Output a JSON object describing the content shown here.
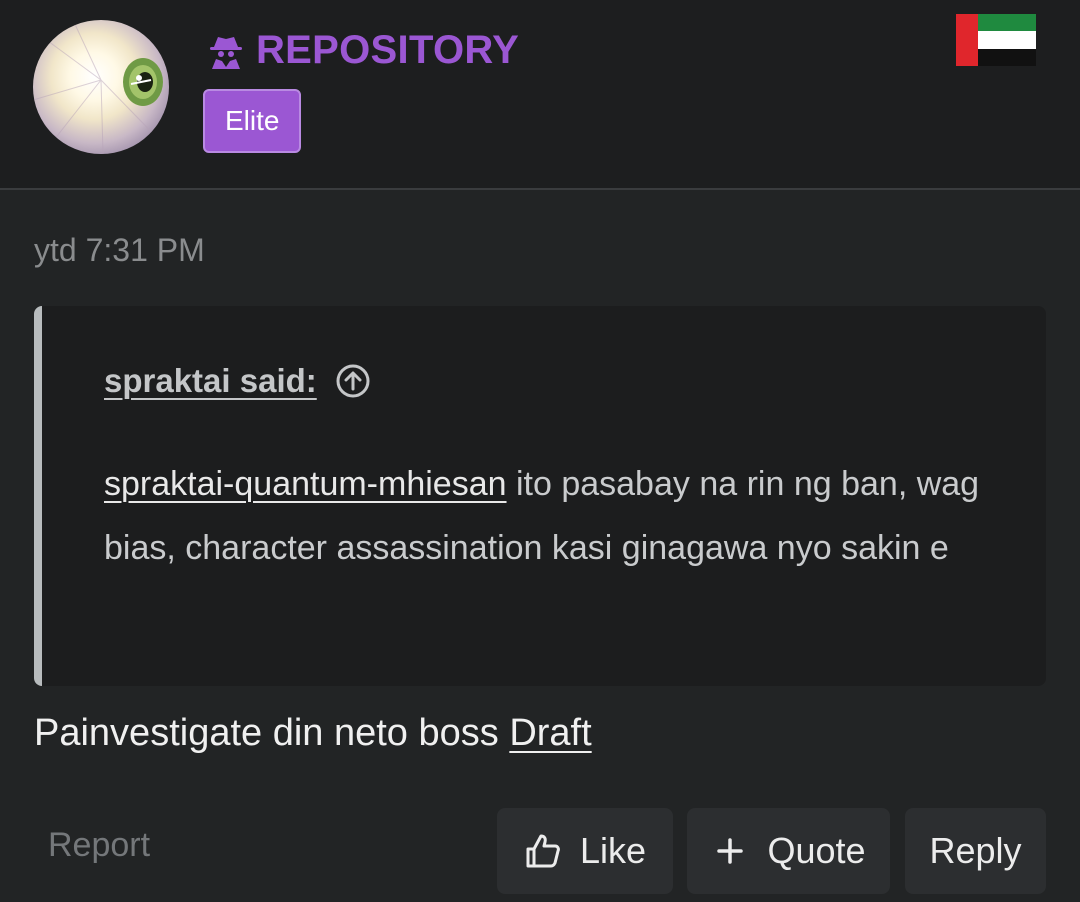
{
  "user": {
    "name": "REPOSITORY",
    "badge": "Elite",
    "role_icon": "spy-icon",
    "flag_icon": "uae-flag-icon"
  },
  "post": {
    "timestamp": "ytd 7:31 PM",
    "quote": {
      "author_label": "spraktai said:",
      "mention": "spraktai-quantum-mhiesan",
      "text": " ito pasabay na rin ng ban, wag bias, character assassination kasi ginagawa nyo sakin e"
    },
    "message": "Painvestigate din neto boss ",
    "message_link": "Draft"
  },
  "actions": {
    "report": "Report",
    "like": "Like",
    "quote": "Quote",
    "reply": "Reply"
  },
  "colors": {
    "accent": "#9b57d3",
    "background": "#222425",
    "header_bg": "#1d1e1f",
    "quote_bg": "#1c1d1e"
  }
}
